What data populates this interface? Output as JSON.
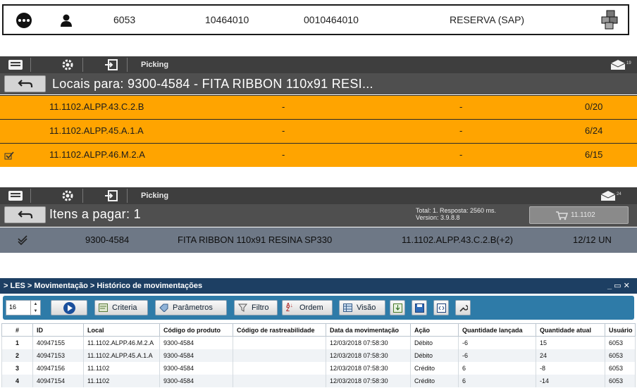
{
  "panel1": {
    "user_id": "6053",
    "col2": "10464010",
    "col3": "0010464010",
    "status": "RESERVA (SAP)",
    "icons": [
      "more-icon",
      "user-icon",
      "boxes-icon"
    ]
  },
  "picking_a": {
    "tab_label": "Picking",
    "badge": "19",
    "title": "Locais para: 9300-4584 - FITA RIBBON 110x91 RESI...",
    "rows": [
      {
        "loc": "11.1102.ALPP.43.C.2.B",
        "c1": "-",
        "c2": "-",
        "qty": "0/20"
      },
      {
        "loc": "11.1102.ALPP.45.A.1.A",
        "c1": "-",
        "c2": "-",
        "qty": "6/24"
      },
      {
        "loc": "11.1102.ALPP.46.M.2.A",
        "c1": "-",
        "c2": "-",
        "qty": "6/15"
      }
    ]
  },
  "picking_b": {
    "tab_label": "Picking",
    "badge": "24",
    "title": "Itens a pagar: 1",
    "info1": "Total: 1. Resposta: 2560 ms.",
    "info2": "Version: 3.9.8.8",
    "cart_label": "11.1102",
    "row": {
      "code": "9300-4584",
      "desc": "FITA RIBBON 110x91 RESINA SP330",
      "loc": "11.1102.ALPP.43.C.2.B(+2)",
      "qty": "12/12 UN"
    }
  },
  "les": {
    "breadcrumb": "> LES > Movimentação > Histórico de movimentações",
    "page_size": "16",
    "buttons": {
      "criteria": "Criteria",
      "parametros": "Parâmetros",
      "filtro": "Filtro",
      "ordem": "Ordem",
      "visao": "Visão"
    },
    "win_controls": "_ ▭ ✕",
    "columns": [
      "#",
      "ID",
      "Local",
      "Código do produto",
      "Código de rastreabilidade",
      "Data da movimentação",
      "Ação",
      "Quantidade lançada",
      "Quantidade atual",
      "Usuário"
    ],
    "rows": [
      [
        "1",
        "40947155",
        "11.1102.ALPP.46.M.2.A",
        "9300-4584",
        "",
        "12/03/2018 07:58:30",
        "Débito",
        "-6",
        "15",
        "6053"
      ],
      [
        "2",
        "40947153",
        "11.1102.ALPP.45.A.1.A",
        "9300-4584",
        "",
        "12/03/2018 07:58:30",
        "Débito",
        "-6",
        "24",
        "6053"
      ],
      [
        "3",
        "40947156",
        "11.1102",
        "9300-4584",
        "",
        "12/03/2018 07:58:30",
        "Crédito",
        "6",
        "-8",
        "6053"
      ],
      [
        "4",
        "40947154",
        "11.1102",
        "9300-4584",
        "",
        "12/03/2018 07:58:30",
        "Crédito",
        "6",
        "-14",
        "6053"
      ]
    ]
  },
  "colors": {
    "orange": "#ffa400",
    "dark": "#3e3e3e",
    "slate": "#6e7886",
    "les_blue": "#2e7ba8",
    "les_navy": "#1d3f63"
  }
}
